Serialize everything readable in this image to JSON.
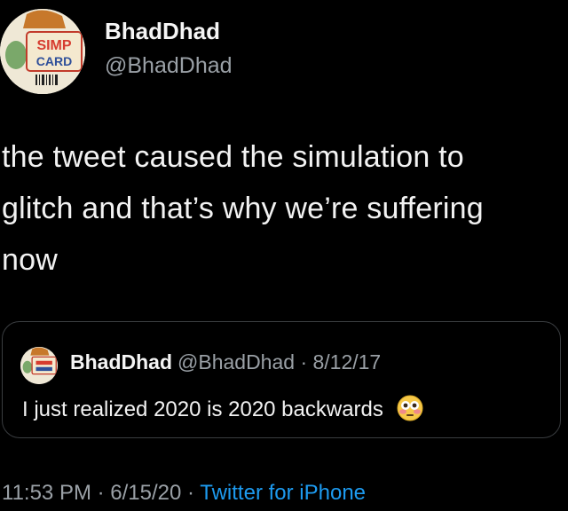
{
  "tweet": {
    "display_name": "BhadDhad",
    "handle": "@BhadDhad",
    "avatar_text_top": "SIMP",
    "avatar_text_bottom": "CARD",
    "text_line1": "the tweet caused the simulation to",
    "text_line2": "glitch and that’s why we’re suffering",
    "text_line3": "now"
  },
  "quoted": {
    "display_name": "BhadDhad",
    "meta": "@BhadDhad · 8/12/17",
    "text": "I just realized 2020 is 2020 backwards",
    "emoji_icon": "flushed-face-icon"
  },
  "footer": {
    "time": "11:53 PM",
    "sep1": " · ",
    "date": "6/15/20",
    "sep2": " · ",
    "source": "Twitter for iPhone"
  },
  "colors": {
    "background": "#000000",
    "secondary_text": "#9aa0a6",
    "link": "#1d9bf0",
    "border": "#3a3d40"
  }
}
